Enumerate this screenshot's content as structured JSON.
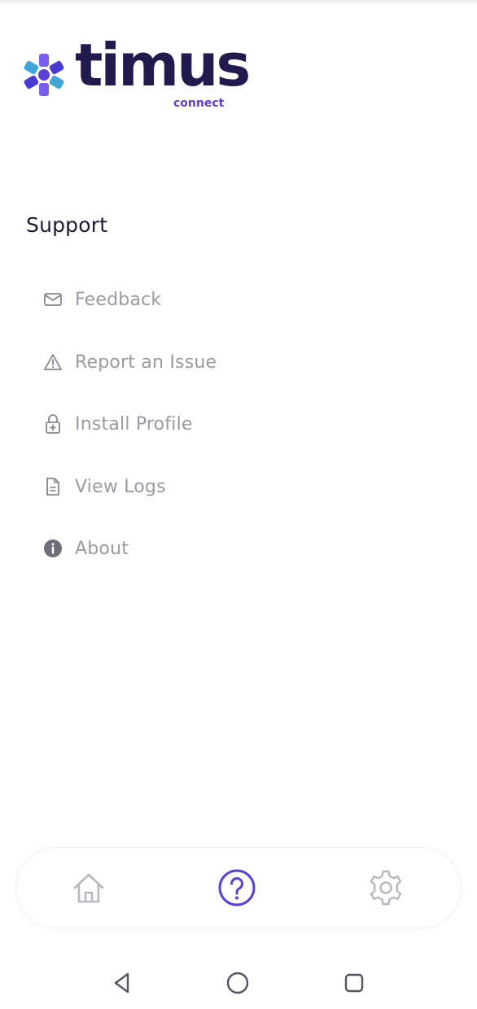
{
  "brand": {
    "name": "timus",
    "sub": "connect",
    "wordmark_color": "#211a4d",
    "sub_color": "#5b3fd6"
  },
  "support": {
    "title": "Support",
    "items": [
      {
        "label": "Feedback",
        "icon": "envelope-icon"
      },
      {
        "label": "Report an Issue",
        "icon": "warning-icon"
      },
      {
        "label": "Install Profile",
        "icon": "lock-plus-icon"
      },
      {
        "label": "View Logs",
        "icon": "document-icon"
      },
      {
        "label": "About",
        "icon": "info-icon"
      }
    ]
  },
  "bottom_nav": {
    "items": [
      {
        "name": "home-icon",
        "active": false
      },
      {
        "name": "help-icon",
        "active": true
      },
      {
        "name": "settings-icon",
        "active": false
      }
    ],
    "active_color": "#5b3fd6",
    "inactive_color": "#b7b7bd"
  },
  "system_nav": [
    "back-icon",
    "home-circle-icon",
    "recents-icon"
  ]
}
